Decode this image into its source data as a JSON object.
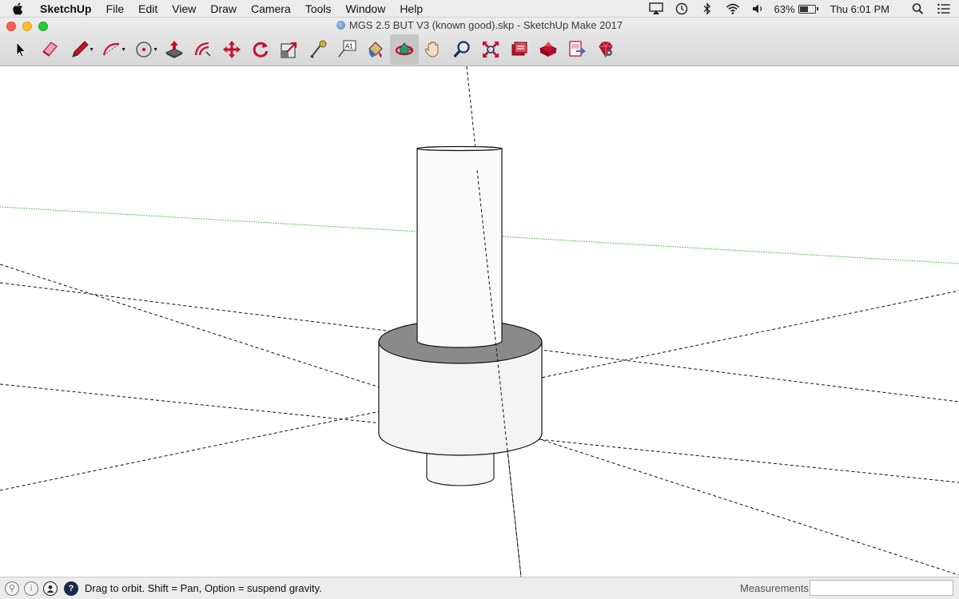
{
  "menubar": {
    "app_name": "SketchUp",
    "items": [
      "File",
      "Edit",
      "View",
      "Draw",
      "Camera",
      "Tools",
      "Window",
      "Help"
    ],
    "battery_text": "63%",
    "battery_level": 0.63,
    "clock": "Thu 6:01 PM"
  },
  "window": {
    "title": "MGS 2.5 BUT V3 (known good).skp - SketchUp Make 2017"
  },
  "toolbar": {
    "tools": [
      {
        "name": "select-tool",
        "icon": "arrow-cursor-icon"
      },
      {
        "name": "eraser-tool",
        "icon": "eraser-icon"
      },
      {
        "name": "line-tool",
        "icon": "pencil-icon",
        "dropdown": true
      },
      {
        "name": "arc-tool",
        "icon": "arc-icon",
        "dropdown": true
      },
      {
        "name": "circle-tool",
        "icon": "circle-icon",
        "dropdown": true
      },
      {
        "name": "push-pull-tool",
        "icon": "push-pull-icon"
      },
      {
        "name": "offset-tool",
        "icon": "offset-icon"
      },
      {
        "name": "move-tool",
        "icon": "move-arrows-icon"
      },
      {
        "name": "rotate-tool",
        "icon": "rotate-icon"
      },
      {
        "name": "scale-tool",
        "icon": "scale-icon"
      },
      {
        "name": "tape-measure-tool",
        "icon": "tape-measure-icon"
      },
      {
        "name": "text-tool",
        "icon": "text-icon"
      },
      {
        "name": "paint-bucket-tool",
        "icon": "paint-bucket-icon"
      },
      {
        "name": "orbit-tool",
        "icon": "orbit-icon",
        "active": true
      },
      {
        "name": "pan-tool",
        "icon": "hand-icon"
      },
      {
        "name": "zoom-tool",
        "icon": "magnifier-icon"
      },
      {
        "name": "zoom-extents-tool",
        "icon": "zoom-extents-icon"
      },
      {
        "name": "3d-warehouse-tool",
        "icon": "warehouse-icon"
      },
      {
        "name": "extension-warehouse-tool",
        "icon": "extension-warehouse-icon"
      },
      {
        "name": "send-to-layout-tool",
        "icon": "layout-icon"
      },
      {
        "name": "extension-manager-tool",
        "icon": "ruby-gem-icon"
      }
    ]
  },
  "statusbar": {
    "hint": "Drag to orbit. Shift = Pan, Option = suspend gravity.",
    "measurements_label": "Measurements",
    "measurements_value": ""
  },
  "colors": {
    "toolbar_bg": "#d7d7d7",
    "sketchup_red": "#c8102e",
    "model_top_face": "#8a8a8a",
    "green_axis": "#2db52d"
  }
}
